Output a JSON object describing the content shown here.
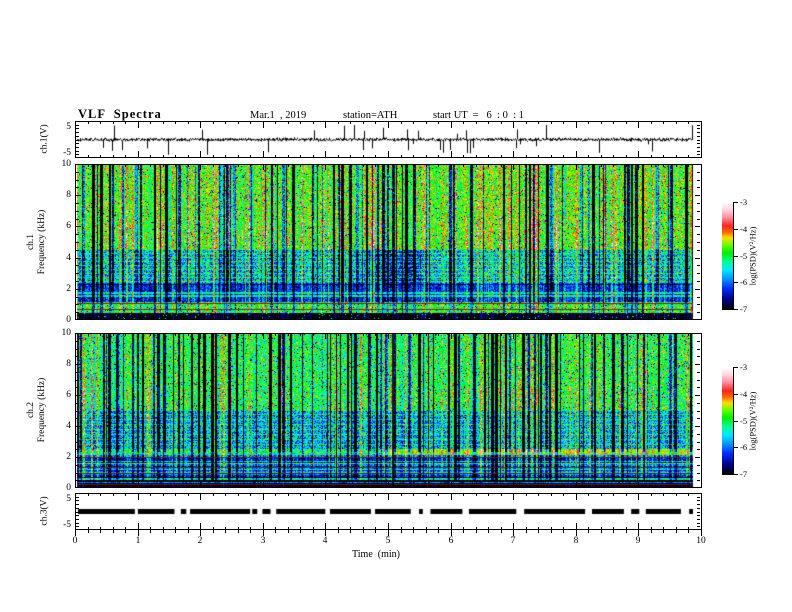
{
  "header": {
    "title": "VLF  Spectra",
    "date": "Mar.1  , 2019",
    "station": "station=ATH",
    "start_ut": "start UT  =   6  : 0  : 1"
  },
  "ylabels": {
    "ch1v": "ch.1(V)",
    "spec1_l1": "ch.1",
    "spec1_l2": "Frequency  (kHz)",
    "spec2_l1": "ch.2",
    "spec2_l2": "Frequency  (kHz)",
    "ch3v": "ch.3(V)"
  },
  "time_axis": {
    "label": "Time  (min)",
    "min": 0,
    "max": 10,
    "major_ticks": [
      0,
      1,
      2,
      3,
      4,
      5,
      6,
      7,
      8,
      9,
      10
    ],
    "minor_step": 0.2
  },
  "volt_axis": {
    "ticks": [
      5,
      -5
    ],
    "min": -5,
    "max": 5,
    "minor_step": 1
  },
  "freq_axis": {
    "ticks": [
      10,
      8,
      6,
      4,
      2,
      0
    ],
    "min": 0,
    "max": 10,
    "minor_step": 0.5
  },
  "colorbar": {
    "label": "log(PSD)(V²/Hz)",
    "ticks": [
      -3,
      -4,
      -5,
      -6,
      -7
    ],
    "min": -7,
    "max": -3,
    "stops": [
      [
        0.0,
        "#000000"
      ],
      [
        0.1,
        "#000090"
      ],
      [
        0.2,
        "#0030ff"
      ],
      [
        0.28,
        "#0090ff"
      ],
      [
        0.37,
        "#00e8ff"
      ],
      [
        0.45,
        "#00ff90"
      ],
      [
        0.53,
        "#00f000"
      ],
      [
        0.6,
        "#60ff00"
      ],
      [
        0.67,
        "#ffe000"
      ],
      [
        0.72,
        "#ff7000"
      ],
      [
        0.78,
        "#ff2020"
      ],
      [
        0.86,
        "#ff8f9f"
      ],
      [
        0.93,
        "#ffd5dd"
      ],
      [
        1.0,
        "#ffffff"
      ]
    ]
  },
  "chart_data": [
    {
      "type": "line",
      "panel": "ch1-voltage",
      "ylabel": "ch.1(V)",
      "x_range": [
        0,
        9.87
      ],
      "y_range": [
        -5,
        5
      ],
      "y_ticks": [
        5,
        -5
      ],
      "description": "broadband noise waveform about ±1 V with frequent impulsive spikes reaching ±5 V",
      "noise_sigma": 0.5,
      "spike_p": 0.055,
      "spike_amp": [
        1.2,
        4.5
      ],
      "seed": 101
    },
    {
      "type": "heatmap",
      "panel": "ch1-spectrogram",
      "ylabel": "ch.1 Frequency (kHz)",
      "x_range": [
        0,
        9.87
      ],
      "y_range": [
        0,
        10
      ],
      "z_label": "log(PSD)(V²/Hz)",
      "z_range": [
        -7,
        -3
      ],
      "seed": 202,
      "dark_stripe_p": 0.18,
      "bright_stripe_p": 0.13,
      "maroon_rows": [
        0.95,
        0.6
      ],
      "maroon_color": "#7a1410",
      "dark_columns": [],
      "bands": [
        {
          "f": [
            4.5,
            10
          ],
          "base": -4.75,
          "noise": 0.5,
          "red_p": 0.035,
          "dark_p": 0.03
        },
        {
          "f": [
            2.3,
            4.5
          ],
          "base": -5.7,
          "noise": 0.7,
          "hline_period": 4,
          "hline_boost": 0.8,
          "pool_t": [
            4.6,
            5.6
          ],
          "pool_drop": 0.6
        },
        {
          "f": [
            1.05,
            2.3
          ],
          "base": -6.25,
          "noise": 0.4,
          "hline_p": 0.25,
          "hline_boost": 1.0
        },
        {
          "f": [
            0.35,
            1.05
          ],
          "base": -4.9,
          "noise": 0.45,
          "red_p": 0.05,
          "dark_p": 0.05
        },
        {
          "f": [
            0,
            0.35
          ],
          "base": -6.95,
          "noise": 0.08,
          "spark_p": 0.03
        }
      ]
    },
    {
      "type": "heatmap",
      "panel": "ch2-spectrogram",
      "ylabel": "ch.2 Frequency (kHz)",
      "x_range": [
        0,
        9.87
      ],
      "y_range": [
        0,
        10
      ],
      "z_label": "log(PSD)(V²/Hz)",
      "z_range": [
        -7,
        -3
      ],
      "seed": 303,
      "dark_stripe_p": 0.2,
      "bright_stripe_p": 0.15,
      "maroon_rows": [
        1.9,
        1.25,
        0.85,
        0.1
      ],
      "maroon_color": "#7a1410",
      "dark_columns": [
        5.05
      ],
      "bands": [
        {
          "f": [
            5,
            10
          ],
          "base": -5.0,
          "noise": 0.55,
          "red_p": 0.012,
          "dark_p": 0.04
        },
        {
          "f": [
            2.45,
            5
          ],
          "base": -5.8,
          "noise": 0.65,
          "hline_period": 5,
          "hline_boost": 0.8
        },
        {
          "f": [
            2.05,
            2.45
          ],
          "base": -5.1,
          "noise": 0.7,
          "t_split": 5,
          "base2": -4.5,
          "noise2": 0.25
        },
        {
          "f": [
            0.25,
            2.05
          ],
          "base": -5.9,
          "noise": 0.4,
          "striped": true
        },
        {
          "f": [
            0,
            0.25
          ],
          "base": -6.95,
          "noise": 0.08
        }
      ]
    },
    {
      "type": "line",
      "panel": "ch3-voltage",
      "ylabel": "ch.3(V)",
      "style": "dashed-bar",
      "x_range": [
        0,
        9.87
      ],
      "y_range": [
        -5,
        5
      ],
      "y_ticks": [
        5,
        -5
      ],
      "description": "constant 0 V level drawn as a thick black interrupted (dashed) bar",
      "level": 0,
      "seed": 404
    }
  ],
  "layout_values": {
    "x_tick_labels": [
      "0",
      "1",
      "2",
      "3",
      "4",
      "5",
      "6",
      "7",
      "8",
      "9",
      "10"
    ],
    "spec_tick_labels": [
      "10",
      "8",
      "6",
      "4",
      "2",
      "0"
    ],
    "volt_tick_labels": [
      "5",
      "-5"
    ],
    "colorbar_tick_labels": [
      "-3",
      "-4",
      "-5",
      "-6",
      "-7"
    ]
  }
}
